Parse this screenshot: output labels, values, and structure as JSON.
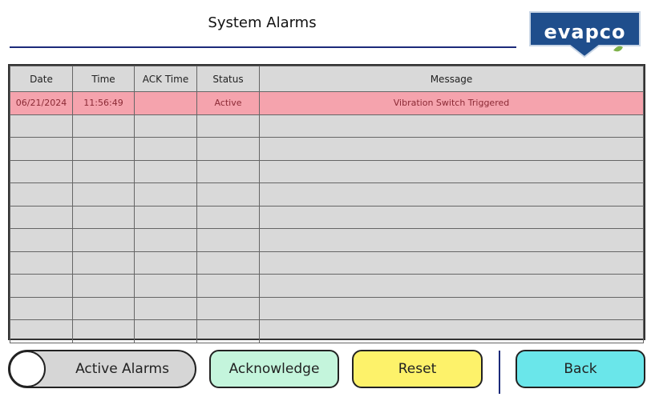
{
  "header": {
    "title": "System Alarms",
    "logo_text": "evapco"
  },
  "table": {
    "columns": [
      "Date",
      "Time",
      "ACK Time",
      "Status",
      "Message"
    ],
    "rows": [
      [
        "06/21/2024",
        "11:56:49",
        "",
        "Active",
        "Vibration Switch Triggered"
      ],
      [
        "",
        "",
        "",
        "",
        ""
      ],
      [
        "",
        "",
        "",
        "",
        ""
      ],
      [
        "",
        "",
        "",
        "",
        ""
      ],
      [
        "",
        "",
        "",
        "",
        ""
      ],
      [
        "",
        "",
        "",
        "",
        ""
      ],
      [
        "",
        "",
        "",
        "",
        ""
      ],
      [
        "",
        "",
        "",
        "",
        ""
      ],
      [
        "",
        "",
        "",
        "",
        ""
      ],
      [
        "",
        "",
        "",
        "",
        ""
      ],
      [
        "",
        "",
        "",
        "",
        ""
      ]
    ]
  },
  "buttons": {
    "active_alarms": "Active Alarms",
    "acknowledge": "Acknowledge",
    "reset": "Reset",
    "back": "Back"
  },
  "colors": {
    "active_alarm_row": "#f5a3ad",
    "acknowledge": "#c4f5dc",
    "reset": "#fdf26a",
    "back": "#6ae6ea",
    "brand": "#1f4e8c"
  }
}
